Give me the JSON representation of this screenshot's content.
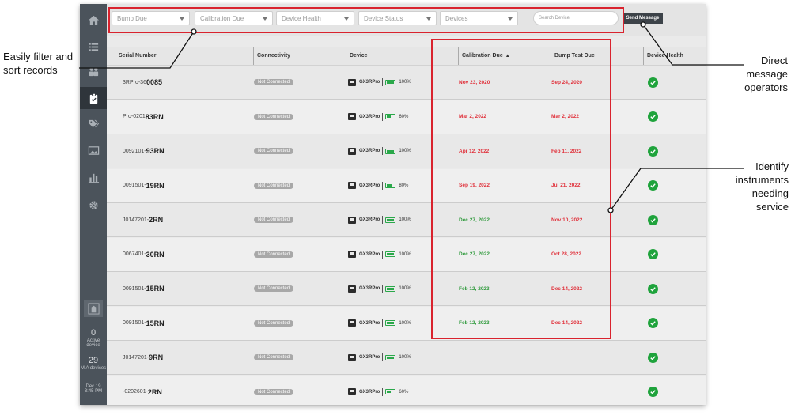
{
  "colors": {
    "overdue": "#e0303a",
    "ok": "#2f9a3c",
    "health_ok": "#1fa33c",
    "highlight_box": "#d9232e"
  },
  "filters": [
    {
      "label": "Bump Due"
    },
    {
      "label": "Calibration Due"
    },
    {
      "label": "Device Health"
    },
    {
      "label": "Device Status"
    },
    {
      "label": "Devices"
    }
  ],
  "search": {
    "placeholder": "Search Device"
  },
  "send_message_label": "Send Message",
  "sidebar": {
    "icons": [
      "home-icon",
      "list-icon",
      "people-icon",
      "clipboard-icon",
      "tags-icon",
      "image-icon",
      "bar-chart-icon",
      "gear-icon",
      "building-icon"
    ],
    "active_devices": {
      "count": "0",
      "label": "Active device"
    },
    "mia_devices": {
      "count": "29",
      "label": "MIA devices"
    },
    "timestamp": {
      "date": "Dec 19",
      "time": "3:45 PM"
    }
  },
  "table": {
    "columns": {
      "serial": "Serial Number",
      "connectivity": "Connectivity",
      "device": "Device",
      "calibration": "Calibration Due",
      "bump": "Bump Test Due",
      "health": "Device Health"
    },
    "rows": [
      {
        "serial_prefix": "3RPro-36",
        "serial_suffix": "0085",
        "connectivity": "Not Connected",
        "device": "GX3RPro",
        "battery": "100%",
        "battery_level": 1.0,
        "calibration": "Nov 23, 2020",
        "calibration_status": "overdue",
        "bump": "Sep 24, 2020",
        "bump_status": "overdue",
        "health": "ok"
      },
      {
        "serial_prefix": "Pro-0201",
        "serial_suffix": "83RN",
        "connectivity": "Not Connected",
        "device": "GX3RPro",
        "battery": "60%",
        "battery_level": 0.6,
        "calibration": "Mar 2, 2022",
        "calibration_status": "overdue",
        "bump": "Mar 2, 2022",
        "bump_status": "overdue",
        "health": "ok"
      },
      {
        "serial_prefix": "0092101-",
        "serial_suffix": "93RN",
        "connectivity": "Not Connected",
        "device": "GX3RPro",
        "battery": "100%",
        "battery_level": 1.0,
        "calibration": "Apr 12, 2022",
        "calibration_status": "overdue",
        "bump": "Feb 11, 2022",
        "bump_status": "overdue",
        "health": "ok"
      },
      {
        "serial_prefix": "0091501-",
        "serial_suffix": "19RN",
        "connectivity": "Not Connected",
        "device": "GX3RPro",
        "battery": "80%",
        "battery_level": 0.8,
        "calibration": "Sep 19, 2022",
        "calibration_status": "overdue",
        "bump": "Jul 21, 2022",
        "bump_status": "overdue",
        "health": "ok"
      },
      {
        "serial_prefix": "J0147201-",
        "serial_suffix": "2RN",
        "connectivity": "Not Connected",
        "device": "GX3RPro",
        "battery": "100%",
        "battery_level": 1.0,
        "calibration": "Dec 27, 2022",
        "calibration_status": "ok",
        "bump": "Nov 10, 2022",
        "bump_status": "overdue",
        "health": "ok"
      },
      {
        "serial_prefix": "0067401-",
        "serial_suffix": "30RN",
        "connectivity": "Not Connected",
        "device": "GX3RPro",
        "battery": "100%",
        "battery_level": 1.0,
        "calibration": "Dec 27, 2022",
        "calibration_status": "ok",
        "bump": "Oct 28, 2022",
        "bump_status": "overdue",
        "health": "ok"
      },
      {
        "serial_prefix": "0091501-",
        "serial_suffix": "15RN",
        "connectivity": "Not Connected",
        "device": "GX3RPro",
        "battery": "100%",
        "battery_level": 1.0,
        "calibration": "Feb 12, 2023",
        "calibration_status": "ok",
        "bump": "Dec 14, 2022",
        "bump_status": "overdue",
        "health": "ok"
      },
      {
        "serial_prefix": "0091501-",
        "serial_suffix": "15RN",
        "connectivity": "Not Connected",
        "device": "GX3RPro",
        "battery": "100%",
        "battery_level": 1.0,
        "calibration": "Feb 12, 2023",
        "calibration_status": "ok",
        "bump": "Dec 14, 2022",
        "bump_status": "overdue",
        "health": "ok"
      },
      {
        "serial_prefix": "J0147201-",
        "serial_suffix": "9RN",
        "connectivity": "Not Connected",
        "device": "GX3RPro",
        "battery": "100%",
        "battery_level": 1.0,
        "calibration": "",
        "calibration_status": "",
        "bump": "",
        "bump_status": "",
        "health": "ok"
      },
      {
        "serial_prefix": "-0202601-",
        "serial_suffix": "2RN",
        "connectivity": "Not Connected",
        "device": "GX3RPro",
        "battery": "60%",
        "battery_level": 0.6,
        "calibration": "",
        "calibration_status": "",
        "bump": "",
        "bump_status": "",
        "health": "ok"
      }
    ]
  },
  "annotations": {
    "filter": "Easily filter and sort records",
    "message": "Direct message operators",
    "service": "Identify instruments needing service"
  }
}
